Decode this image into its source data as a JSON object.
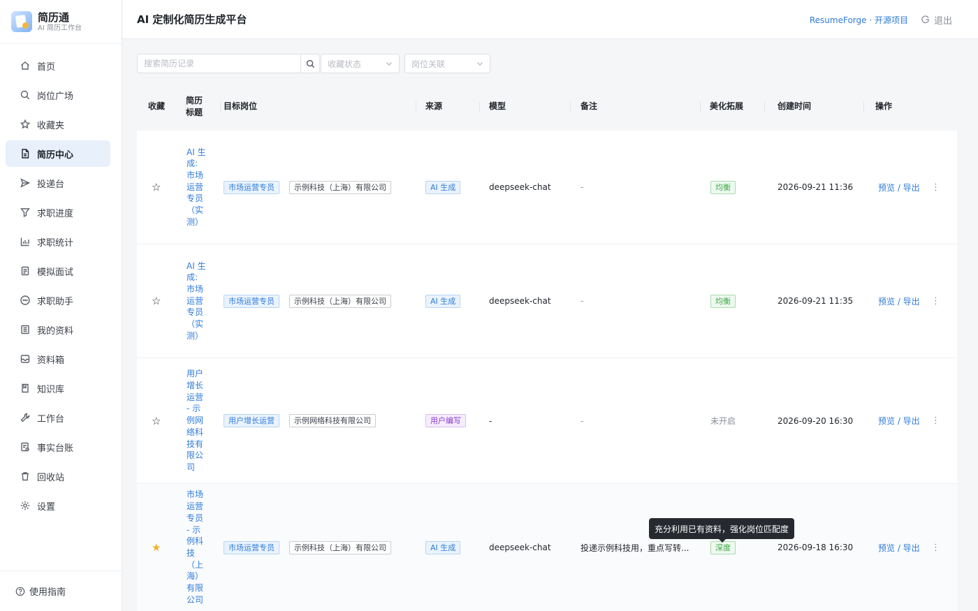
{
  "brand": {
    "title": "简历通",
    "subtitle": "AI 简历工作台"
  },
  "header": {
    "title": "AI 定制化简历生成平台",
    "link": "ResumeForge · 开源项目",
    "logout": "退出"
  },
  "sidebar": {
    "items": [
      {
        "label": "首页",
        "icon": "home-icon"
      },
      {
        "label": "岗位广场",
        "icon": "search-icon"
      },
      {
        "label": "收藏夹",
        "icon": "star-icon"
      },
      {
        "label": "简历中心",
        "icon": "document-icon",
        "active": true
      },
      {
        "label": "投递台",
        "icon": "send-icon"
      },
      {
        "label": "求职进度",
        "icon": "funnel-icon"
      },
      {
        "label": "求职统计",
        "icon": "bar-chart-icon"
      },
      {
        "label": "模拟面试",
        "icon": "clipboard-icon"
      },
      {
        "label": "求职助手",
        "icon": "chat-icon"
      },
      {
        "label": "我的资料",
        "icon": "list-icon"
      },
      {
        "label": "资料箱",
        "icon": "inbox-icon"
      },
      {
        "label": "知识库",
        "icon": "book-icon"
      },
      {
        "label": "工作台",
        "icon": "wrench-icon"
      },
      {
        "label": "事实台账",
        "icon": "ledger-icon"
      },
      {
        "label": "回收站",
        "icon": "trash-icon"
      },
      {
        "label": "设置",
        "icon": "gear-icon"
      }
    ],
    "guide": "使用指南"
  },
  "filters": {
    "search_placeholder": "搜索简历记录",
    "favorite_placeholder": "收藏状态",
    "job_placeholder": "岗位关联"
  },
  "table": {
    "columns": {
      "favorite": "收藏",
      "title": "简历标题",
      "target": "目标岗位",
      "source": "来源",
      "model": "模型",
      "note": "备注",
      "beautify": "美化拓展",
      "created": "创建时间",
      "ops": "操作"
    },
    "rows": [
      {
        "favorite": false,
        "title": "AI 生成: 市场运营专员（实测）",
        "job": "市场运营专员",
        "company": "示例科技（上海）有限公司",
        "source": "AI 生成",
        "source_color": "blue",
        "model": "deepseek-chat",
        "note": "-",
        "beautify": "均衡",
        "beautify_type": "tag",
        "created": "2026-09-21 11:36",
        "ops": "预览 / 导出",
        "more": "⋮"
      },
      {
        "favorite": false,
        "title": "AI 生成: 市场运营专员（实测）",
        "job": "市场运营专员",
        "company": "示例科技（上海）有限公司",
        "source": "AI 生成",
        "source_color": "blue",
        "model": "deepseek-chat",
        "note": "-",
        "beautify": "均衡",
        "beautify_type": "tag",
        "created": "2026-09-21 11:35",
        "ops": "预览 / 导出",
        "more": "⋮"
      },
      {
        "favorite": false,
        "title": "用户增长运营 - 示例网络科技有限公司",
        "job": "用户增长运营",
        "company": "示例网络科技有限公司",
        "source": "用户编写",
        "source_color": "purple",
        "model": "-",
        "note": "-",
        "beautify": "未开启",
        "beautify_type": "text",
        "created": "2026-09-20 16:30",
        "ops": "预览 / 导出",
        "more": "⋮"
      },
      {
        "favorite": true,
        "title": "市场运营专员 - 示例科技（上海）有限公司",
        "job": "市场运营专员",
        "company": "示例科技（上海）有限公司",
        "source": "AI 生成",
        "source_color": "blue",
        "model": "deepseek-chat",
        "note": "投递示例科技用，重点写转...",
        "beautify": "深度",
        "beautify_type": "tag",
        "created": "2026-09-18 16:30",
        "ops": "预览 / 导出",
        "more": "⋮"
      }
    ]
  },
  "tooltip": "充分利用已有资料，强化岗位匹配度",
  "colors": {
    "primary": "#2f7bd8",
    "active_bg": "#e7f0fb",
    "star_on": "#f0b12a"
  }
}
